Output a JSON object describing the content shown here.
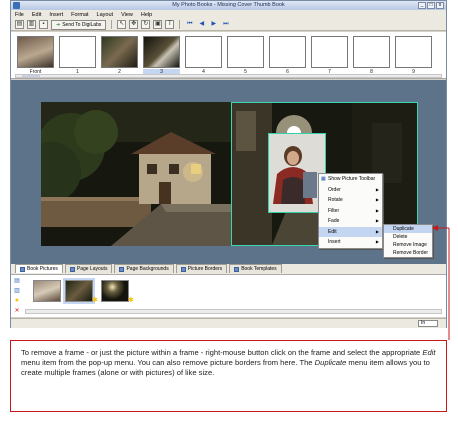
{
  "window": {
    "title": "My Photo Books - Missing Cover Thumb Book",
    "controls": [
      "_",
      "□",
      "x"
    ]
  },
  "menu": [
    "File",
    "Edit",
    "Insert",
    "Format",
    "Layout",
    "View",
    "Help"
  ],
  "toolbar": {
    "send_button": "Send To DigiLabs"
  },
  "thumbnails": [
    {
      "label": "Front",
      "selected": false
    },
    {
      "label": "1",
      "selected": false
    },
    {
      "label": "2",
      "selected": false
    },
    {
      "label": "3",
      "selected": true
    },
    {
      "label": "4",
      "selected": false
    },
    {
      "label": "5",
      "selected": false
    },
    {
      "label": "6",
      "selected": false
    },
    {
      "label": "7",
      "selected": false
    },
    {
      "label": "8",
      "selected": false
    },
    {
      "label": "9",
      "selected": false
    }
  ],
  "context_menu": {
    "items": [
      "Show Picture Toolbar",
      "Order",
      "Rotate",
      "Filter",
      "Fade",
      "Edit",
      "Insert"
    ],
    "edit_submenu": [
      "Duplicate",
      "Delete",
      "Remove Image",
      "Remove Border"
    ]
  },
  "tabs": [
    "Book Pictures",
    "Page Layouts",
    "Page Backgrounds",
    "Picture Borders",
    "Book Templates"
  ],
  "status": {
    "zoom": "In"
  },
  "caption": {
    "part1": "To remove a frame - or just the picture within a frame - right-mouse button click on the frame and select the appropriate ",
    "em1": "Edit",
    "part2": " menu item from the pop-up menu. You can also remove picture borders from here. The ",
    "em2": "Duplicate",
    "part3": " menu item allows you to create multiple frames (alone or with pictures) of like size."
  },
  "colors": {
    "workspace": "#5d7389",
    "selection_frame": "#36d0a8",
    "caption_border": "#c8171c",
    "highlight": "#c3d5f0"
  }
}
